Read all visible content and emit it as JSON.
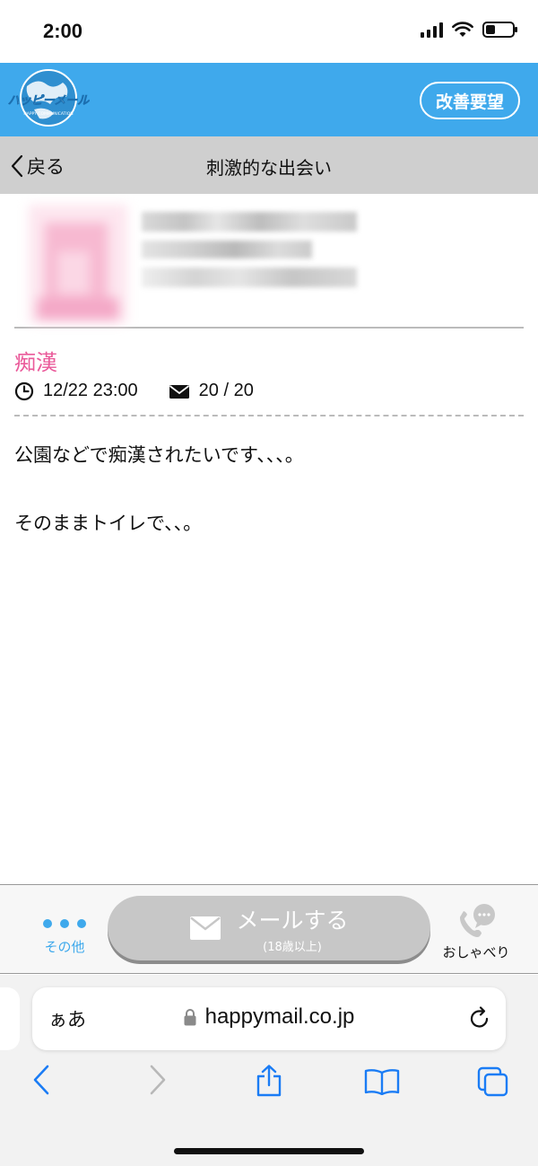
{
  "status_bar": {
    "time": "2:00"
  },
  "header": {
    "logo_name": "happy-mail-logo",
    "logo_text": "ハッピーメール",
    "logo_sub": "HAPPY COMMUNICATION",
    "improve_label": "改善要望",
    "brand_color": "#3fa9ec"
  },
  "nav": {
    "back_label": "戻る",
    "title": "刺激的な出会い"
  },
  "post": {
    "category": "痴漢",
    "datetime": "12/22 23:00",
    "mail_count": "20 / 20",
    "message_lines": [
      "公園などで痴漢されたいです、、、。",
      "",
      "そのままトイレで、、。"
    ],
    "category_color": "#ea5a9a"
  },
  "action_bar": {
    "other_label": "その他",
    "mail_label": "メールする",
    "mail_sub": "(18歳以上)",
    "chat_label": "おしゃべり"
  },
  "safari": {
    "aa_label": "ぁあ",
    "url": "happymail.co.jp"
  }
}
